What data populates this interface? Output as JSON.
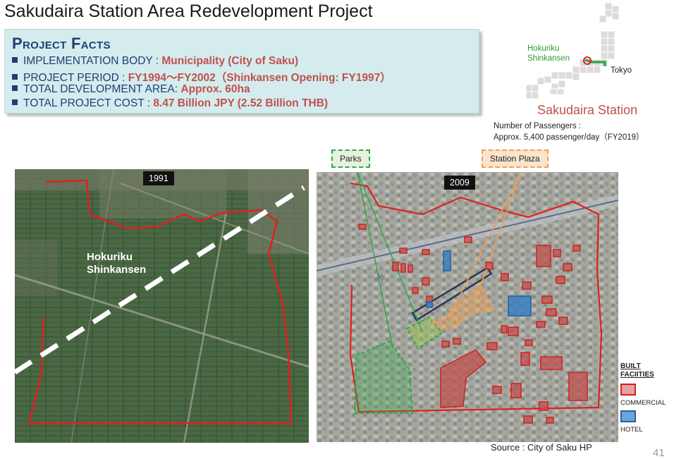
{
  "title": "Sakudaira Station Area Redevelopment Project",
  "facts": {
    "heading": "Project Facts",
    "rows": [
      {
        "label": "IMPLEMENTATION BODY : ",
        "value": "Municipality (City of Saku)"
      },
      {
        "label": "PROJECT PERIOD : ",
        "value": "FY1994〜FY2002（Shinkansen Opening: FY1997）"
      },
      {
        "label": "TOTAL DEVELOPMENT AREA: ",
        "value": "Approx. 60ha"
      },
      {
        "label": "TOTAL PROJECT COST : ",
        "value": "8.47 Billion JPY (2.52 Billion THB)"
      }
    ]
  },
  "inset": {
    "line_label_1": "Hokuriku",
    "line_label_2": "Shinkansen",
    "tokyo": "Tokyo",
    "station": "Sakudaira Station",
    "passengers_1": "Number of Passengers :",
    "passengers_2": "Approx. 5,400 passenger/day（FY2019）"
  },
  "photo1": {
    "year": "1991",
    "line_label_1": "Hokuriku",
    "line_label_2": "Shinkansen"
  },
  "photo2": {
    "year": "2009"
  },
  "callouts": {
    "parks": "Parks",
    "plaza": "Station Plaza"
  },
  "legend": {
    "title_1": "BUILT",
    "title_2": "FACIITIES",
    "commercial": "COMMERCIAL",
    "hotel": "HOTEL"
  },
  "colors": {
    "commercial": "#c0504d",
    "hotel": "#3a7fc4",
    "parks": "#2fa84a",
    "plaza": "#f0a050",
    "boundary": "#e02020"
  },
  "source": "Source : City of Saku HP",
  "page_number": "41"
}
